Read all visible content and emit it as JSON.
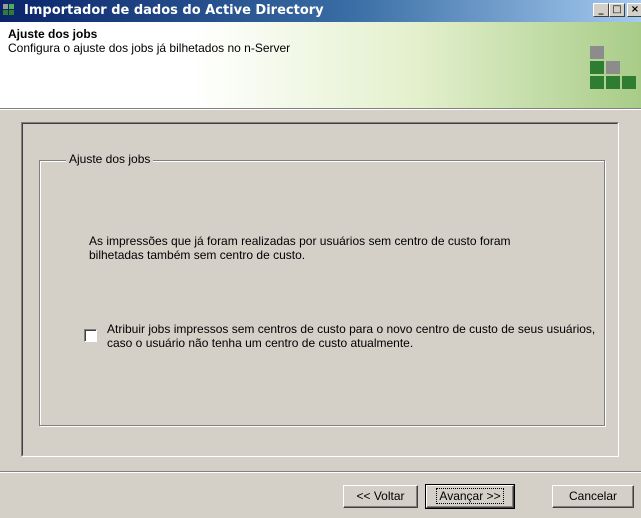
{
  "window": {
    "title": "Importador de dados do Active Directory",
    "controls": {
      "minimize": "_",
      "maximize": "□",
      "close": "×"
    }
  },
  "header": {
    "title": "Ajuste dos jobs",
    "subtitle": "Configura o ajuste dos jobs já bilhetados no n-Server"
  },
  "group": {
    "legend": "Ajuste dos jobs",
    "info_text": "As impressões que já foram realizadas por usuários sem centro de custo foram bilhetadas também sem centro de custo.",
    "checkbox_label": "Atribuir jobs impressos sem centros de custo para o novo centro de custo de seus usuários, caso o usuário não tenha um centro de custo atualmente.",
    "checkbox_checked": false
  },
  "buttons": {
    "back": "<< Voltar",
    "next": "Avançar >>",
    "cancel": "Cancelar"
  },
  "colors": {
    "titlebar_start": "#0a246a",
    "titlebar_end": "#a6caf0",
    "dialog_face": "#d4d0c8",
    "logo_gray": "#8c8c8c",
    "logo_green": "#2e7d32"
  }
}
